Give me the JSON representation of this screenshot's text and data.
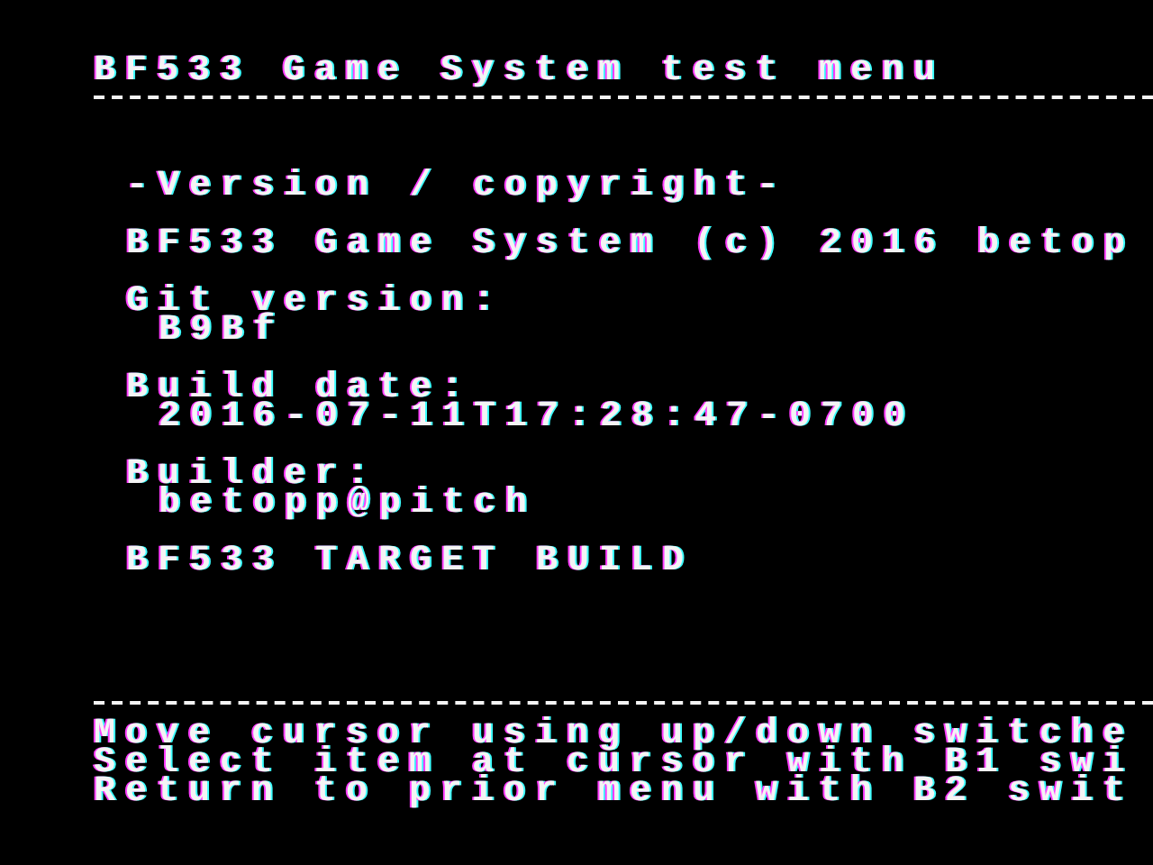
{
  "header": {
    "title": "BF533 Game System test menu"
  },
  "section": {
    "heading": "-Version / copyright-",
    "copyright": "BF533 Game System (c) 2016 betop",
    "fields": [
      {
        "label": "Git version:",
        "value": "B9Bf"
      },
      {
        "label": "Build date:",
        "value": "2016-07-11T17:28:47-0700"
      },
      {
        "label": "Builder:",
        "value": "betopp@pitch"
      }
    ],
    "build_target": "BF533 TARGET BUILD"
  },
  "footer": {
    "help_lines": [
      "Move cursor using up/down switche",
      "Select item at cursor with B1 swi",
      "Return to prior menu with B2 swit"
    ]
  }
}
